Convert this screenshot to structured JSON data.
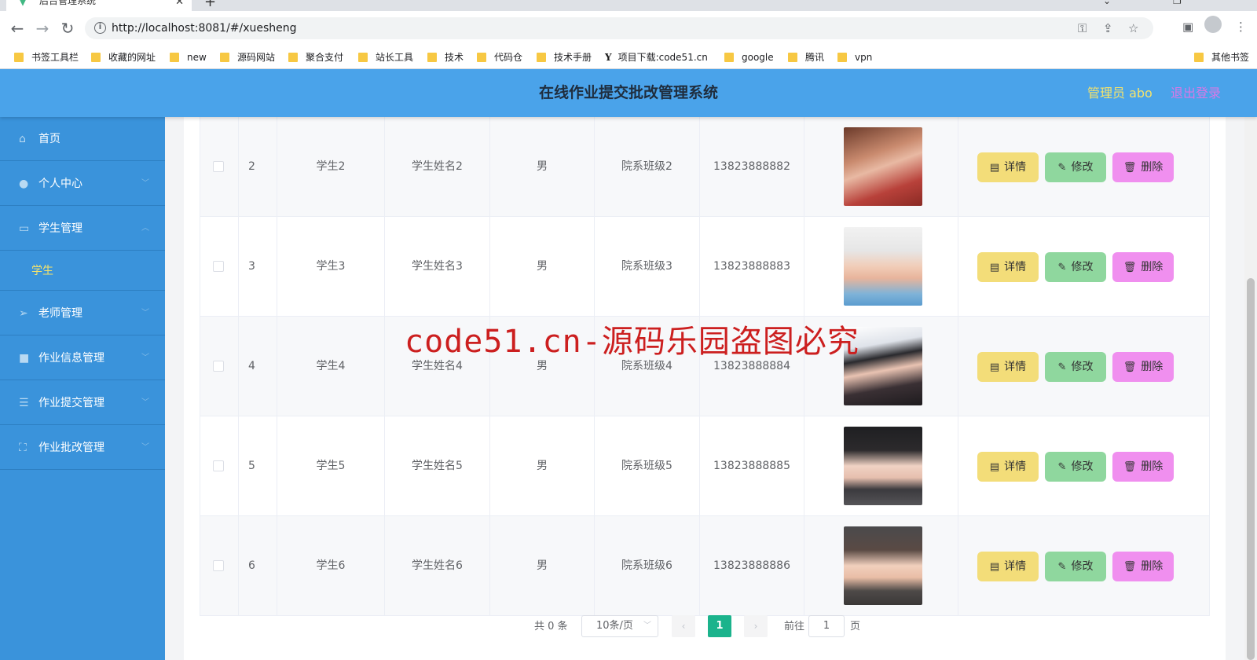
{
  "browser": {
    "tab_title": "后台管理系统",
    "url": "http://localhost:8081/#/xuesheng",
    "bookmarks": [
      "书签工具栏",
      "收藏的网址",
      "new",
      "源码网站",
      "聚合支付",
      "站长工具",
      "技术",
      "代码仓",
      "技术手册",
      "项目下载:code51.cn",
      "google",
      "腾讯",
      "vpn"
    ],
    "other_bookmarks": "其他书签"
  },
  "header": {
    "title": "在线作业提交批改管理系统",
    "admin": "管理员 abo",
    "logout": "退出登录",
    "color": "#4aa3ea"
  },
  "sidebar": {
    "color": "#3a93db",
    "items": [
      {
        "label": "首页",
        "icon": "home-icon"
      },
      {
        "label": "个人中心",
        "icon": "user-icon"
      },
      {
        "label": "学生管理",
        "icon": "chat-icon"
      },
      {
        "label": "老师管理",
        "icon": "send-icon"
      },
      {
        "label": "作业信息管理",
        "icon": "video-icon"
      },
      {
        "label": "作业提交管理",
        "icon": "list-icon"
      },
      {
        "label": "作业批改管理",
        "icon": "fullscreen-icon"
      }
    ],
    "subitem": "学生"
  },
  "table": {
    "rows": [
      {
        "index": "2",
        "account": "学生2",
        "name": "学生姓名2",
        "gender": "男",
        "class": "院系班级2",
        "phone": "13823888882"
      },
      {
        "index": "3",
        "account": "学生3",
        "name": "学生姓名3",
        "gender": "男",
        "class": "院系班级3",
        "phone": "13823888883"
      },
      {
        "index": "4",
        "account": "学生4",
        "name": "学生姓名4",
        "gender": "男",
        "class": "院系班级4",
        "phone": "13823888884"
      },
      {
        "index": "5",
        "account": "学生5",
        "name": "学生姓名5",
        "gender": "男",
        "class": "院系班级5",
        "phone": "13823888885"
      },
      {
        "index": "6",
        "account": "学生6",
        "name": "学生姓名6",
        "gender": "男",
        "class": "院系班级6",
        "phone": "13823888886"
      }
    ],
    "actions": {
      "detail": "详情",
      "edit": "修改",
      "delete": "删除"
    }
  },
  "pagination": {
    "total": "共 0 条",
    "page_size": "10条/页",
    "current_page": "1",
    "goto_label": "前往",
    "goto_value": "1",
    "page_suffix": "页"
  },
  "watermark": "code51.cn-源码乐园盗图必究"
}
